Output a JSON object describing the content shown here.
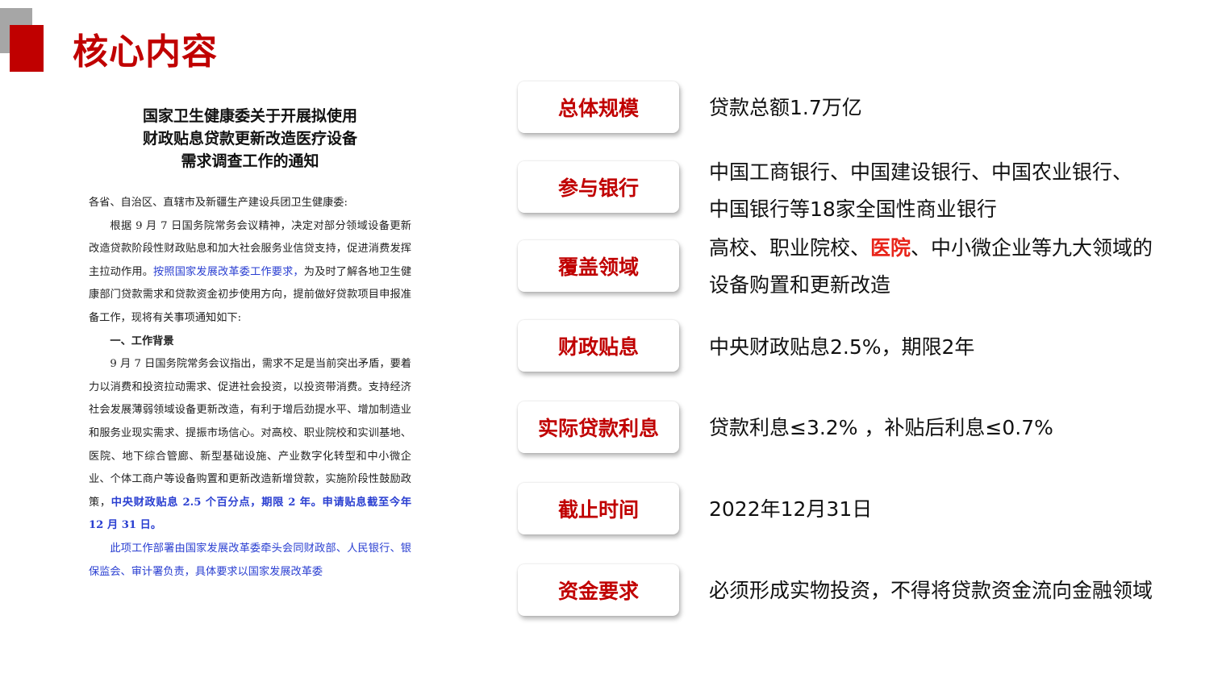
{
  "header": {
    "title": "核心内容"
  },
  "document": {
    "title_lines": [
      "国家卫生健康委关于开展拟使用",
      "财政贴息贷款更新改造医疗设备",
      "需求调查工作的通知"
    ],
    "salutation": "各省、自治区、直辖市及新疆生产建设兵团卫生健康委:",
    "p1_a": "根据 9 月 7 日国务院常务会议精神，决定对部分领域设备更新改造贷款阶段性财政贴息和加大社会服务业信贷支持，促进消费发挥主拉动作用。",
    "p1_b": "按照国家发展改革委工作要求，",
    "p1_c": "为及时了解各地卫生健康部门贷款需求和贷款资金初步使用方向，提前做好贷款项目申报准备工作，现将有关事项通知如下:",
    "section1": "一、工作背景",
    "p2_a": "9 月 7 日国务院常务会议指出，需求不足是当前突出矛盾，要着力以消费和投资拉动需求、促进社会投资，以投资带消费。支持经济社会发展薄弱领域设备更新改造，有利于增后劲提水平、增加制造业和服务业现实需求、提振市场信心。对高校、职业院校和实训基地、医院、地下综合管廊、新型基础设施、产业数字化转型和中小微企业、个体工商户等设备购置和更新改造新增贷款，实施阶段性鼓励政策，",
    "p2_b": "中央财政贴息 2.5 个百分点，期限 2 年。申请贴息截至今年 12 月 31 日。",
    "p3": "此项工作部署由国家发展改革委牵头会同财政部、人民银行、银保监会、审计署负责，具体要求以国家发展改革委"
  },
  "rows": [
    {
      "label": "总体规模",
      "lines": [
        "贷款总额1.7万亿"
      ]
    },
    {
      "label": "参与银行",
      "lines": [
        "中国工商银行、中国建设银行、中国农业银行、",
        "中国银行等18家全国性商业银行"
      ]
    },
    {
      "label": "覆盖领域",
      "line1_a": "高校、职业院校、",
      "line1_hl": "医院",
      "line1_b": "、中小微企业等九大领域的",
      "line2": "设备购置和更新改造"
    },
    {
      "label": "财政贴息",
      "lines": [
        "中央财政贴息2.5%，期限2年"
      ]
    },
    {
      "label": "实际贷款利息",
      "lines": [
        "贷款利息≤3.2% ，补贴后利息≤0.7%"
      ]
    },
    {
      "label": "截止时间",
      "lines": [
        "2022年12月31日"
      ]
    },
    {
      "label": "资金要求",
      "lines": [
        "必须形成实物投资，不得将贷款资金流向金融领域"
      ]
    }
  ],
  "colors": {
    "accent": "#c00000",
    "highlight": "#e8251b",
    "doc_link": "#2a3fd1"
  }
}
